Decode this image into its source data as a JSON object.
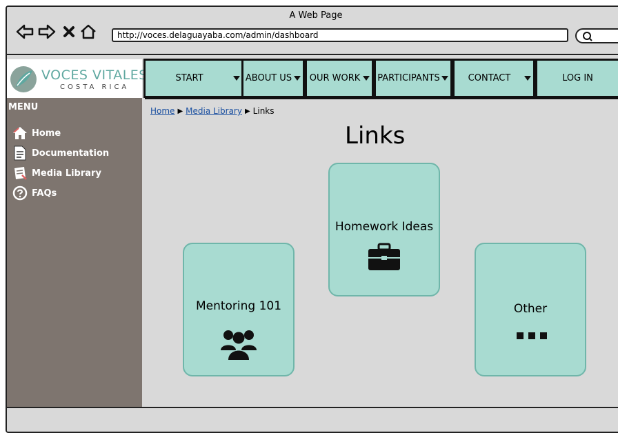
{
  "browser": {
    "window_title": "A Web Page",
    "url": "http://voces.delaguayaba.com/admin/dashboard"
  },
  "brand": {
    "title": "VOCES VITALES",
    "subtitle": "COSTA RICA",
    "accent": "#5fa8a0"
  },
  "nav": {
    "items": [
      {
        "label": "START"
      },
      {
        "label": "ABOUT US"
      },
      {
        "label": "OUR WORK"
      },
      {
        "label": "PARTICIPANTS"
      },
      {
        "label": "CONTACT"
      },
      {
        "label": "LOG IN"
      }
    ]
  },
  "sidebar": {
    "menu_label": "MENU",
    "items": [
      {
        "label": "Home",
        "icon": "home-icon"
      },
      {
        "label": "Documentation",
        "icon": "document-icon"
      },
      {
        "label": "Media Library",
        "icon": "media-library-icon"
      },
      {
        "label": "FAQs",
        "icon": "help-icon"
      }
    ]
  },
  "breadcrumb": [
    {
      "label": "Home"
    },
    {
      "label": "Media Library"
    },
    {
      "label": "Links"
    }
  ],
  "page": {
    "title": "Links"
  },
  "cards": [
    {
      "label": "Homework Ideas",
      "icon": "briefcase-icon"
    },
    {
      "label": "Mentoring 101",
      "icon": "group-icon"
    },
    {
      "label": "Other",
      "icon": "more-icon"
    }
  ],
  "colors": {
    "card_fill": "#a8dbd1",
    "sidebar": "#7e756f",
    "link": "#1a4fa0"
  }
}
